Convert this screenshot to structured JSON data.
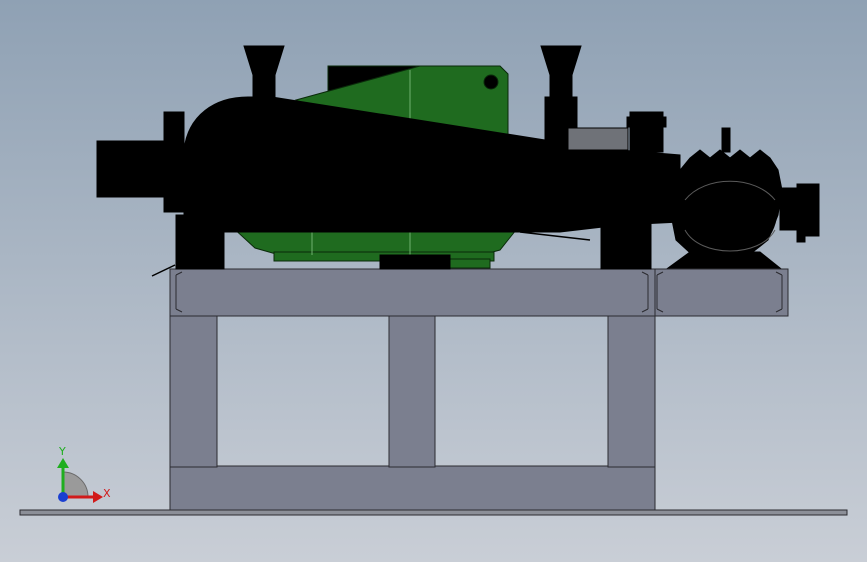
{
  "viewport": {
    "background_top": "#8fa1b4",
    "background_bottom": "#c9ced6"
  },
  "model": {
    "equipment_color": "#000000",
    "motor_housing_color": "#1f6b1f",
    "frame_color": "#7b7f8f",
    "frame_edge_color": "#2b2b30"
  },
  "triad": {
    "x_label": "X",
    "y_label": "Y",
    "x_color": "#d11a1a",
    "y_color": "#1fae1f",
    "z_color": "#1a3fd1"
  }
}
